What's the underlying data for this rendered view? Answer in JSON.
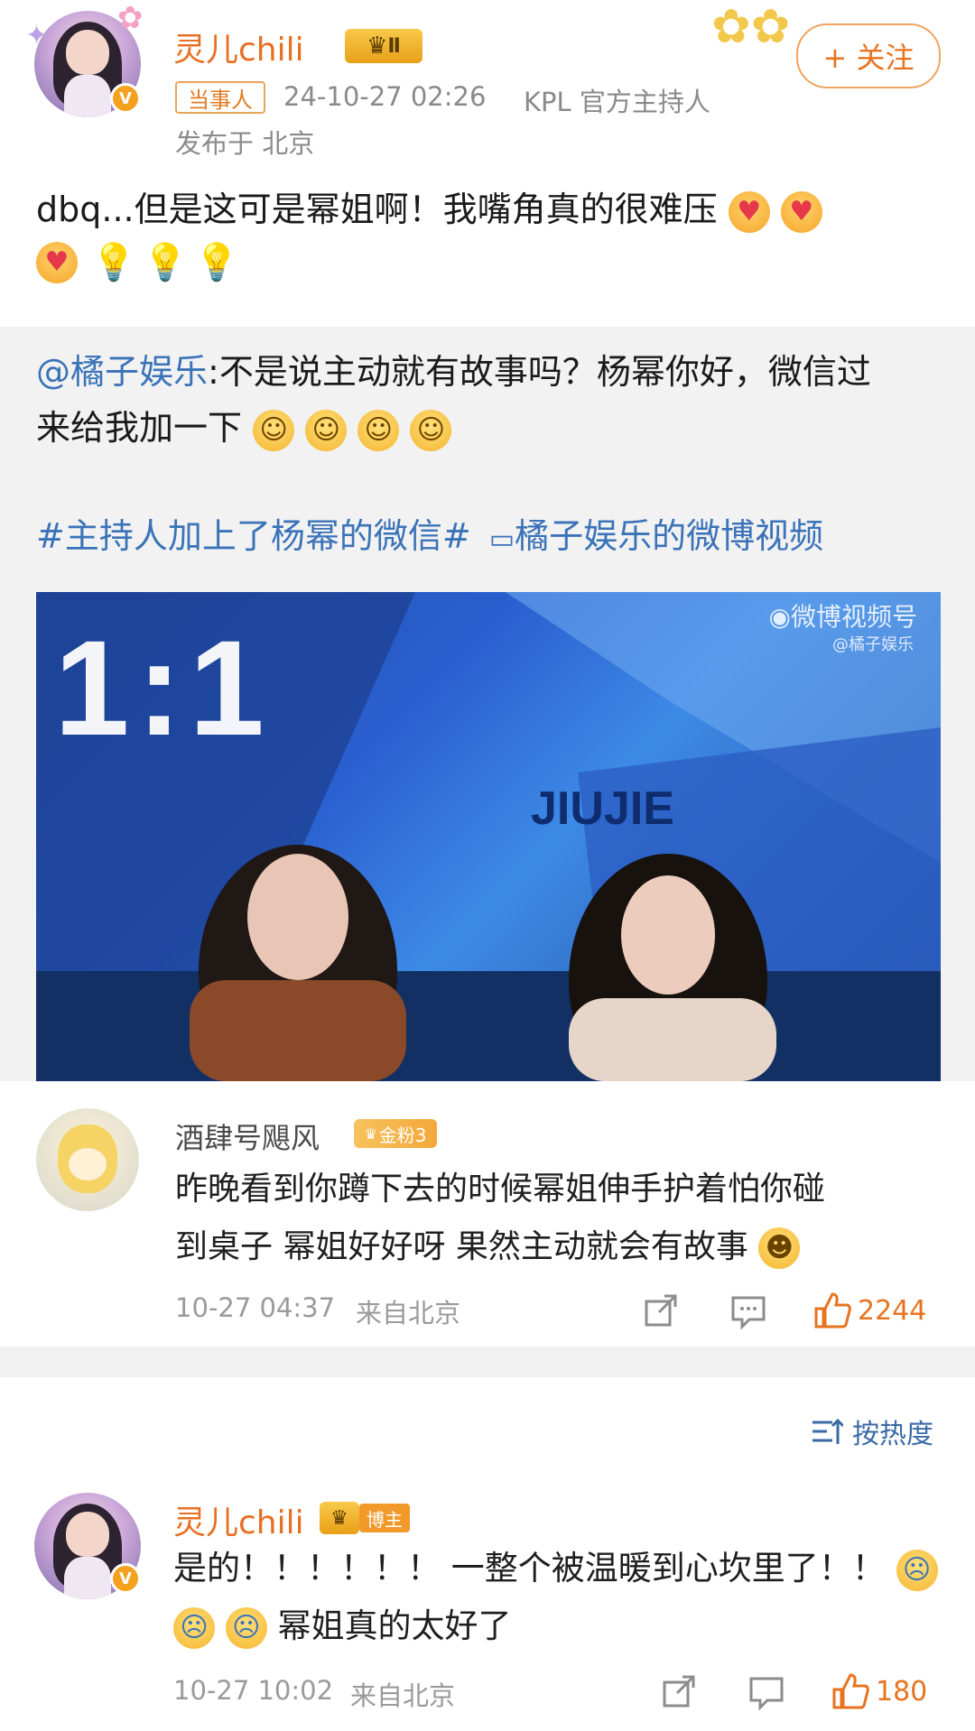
{
  "post": {
    "author_name": "灵儿chili",
    "level_badge": "Ⅱ",
    "follow_label": "+ 关注",
    "tag": "当事人",
    "timestamp": "24-10-27 02:26",
    "role": "KPL 官方主持人",
    "location": "发布于 北京",
    "text": "dbq...但是这可是幂姐啊！我嘴角真的很难压"
  },
  "repost": {
    "mention": "@橘子娱乐",
    "text_part1": ":不是说主动就有故事吗？杨幂你好，微信过",
    "text_part2": "来给我加一下",
    "hashtag": "#主持人加上了杨幂的微信#",
    "video_link": "橘子娱乐的微博视频",
    "video_watermark": "微博视频号",
    "video_watermark_sub": "@橘子娱乐",
    "video_score": "1:1",
    "video_logo": "JIUJIE"
  },
  "hot_comment": {
    "author_name": "酒肆号飓风",
    "fan_badge": "金粉3",
    "text_line1": "昨晚看到你蹲下去的时候幂姐伸手护着怕你碰",
    "text_line2": "到桌子 幂姐好好呀 果然主动就会有故事",
    "time": "10-27 04:37",
    "location": "来自北京",
    "like_count": "2244"
  },
  "sort_label": "按热度",
  "reply": {
    "author_name": "灵儿chili",
    "badge": "博主",
    "text_line1": "是的！！！！！！ 一整个被温暖到心坎里了！！",
    "text_line2": "幂姐真的太好了",
    "time": "10-27 10:02",
    "location": "来自北京",
    "like_count": "180"
  },
  "colors": {
    "accent_orange": "#e8731f",
    "link_blue": "#3b73b8"
  }
}
